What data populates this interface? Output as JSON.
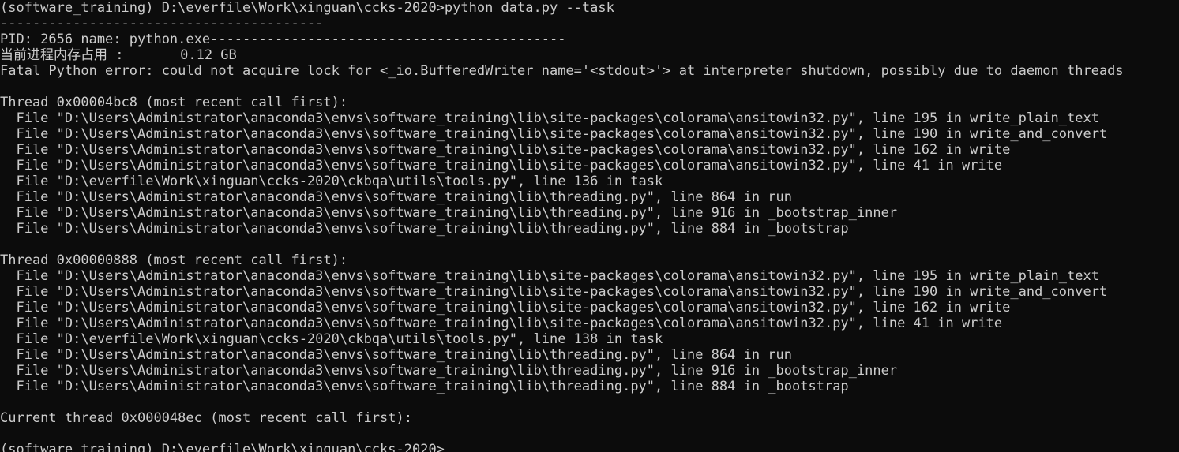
{
  "terminal": {
    "lines": [
      "(software_training) D:\\everfile\\Work\\xinguan\\ccks-2020>python data.py --task",
      "----------------------------------------",
      "PID: 2656 name: python.exe--------------------------------------------",
      "当前进程内存占用 :       0.12 GB",
      "Fatal Python error: could not acquire lock for <_io.BufferedWriter name='<stdout>'> at interpreter shutdown, possibly due to daemon threads",
      "",
      "Thread 0x00004bc8 (most recent call first):",
      "  File \"D:\\Users\\Administrator\\anaconda3\\envs\\software_training\\lib\\site-packages\\colorama\\ansitowin32.py\", line 195 in write_plain_text",
      "  File \"D:\\Users\\Administrator\\anaconda3\\envs\\software_training\\lib\\site-packages\\colorama\\ansitowin32.py\", line 190 in write_and_convert",
      "  File \"D:\\Users\\Administrator\\anaconda3\\envs\\software_training\\lib\\site-packages\\colorama\\ansitowin32.py\", line 162 in write",
      "  File \"D:\\Users\\Administrator\\anaconda3\\envs\\software_training\\lib\\site-packages\\colorama\\ansitowin32.py\", line 41 in write",
      "  File \"D:\\everfile\\Work\\xinguan\\ccks-2020\\ckbqa\\utils\\tools.py\", line 136 in task",
      "  File \"D:\\Users\\Administrator\\anaconda3\\envs\\software_training\\lib\\threading.py\", line 864 in run",
      "  File \"D:\\Users\\Administrator\\anaconda3\\envs\\software_training\\lib\\threading.py\", line 916 in _bootstrap_inner",
      "  File \"D:\\Users\\Administrator\\anaconda3\\envs\\software_training\\lib\\threading.py\", line 884 in _bootstrap",
      "",
      "Thread 0x00000888 (most recent call first):",
      "  File \"D:\\Users\\Administrator\\anaconda3\\envs\\software_training\\lib\\site-packages\\colorama\\ansitowin32.py\", line 195 in write_plain_text",
      "  File \"D:\\Users\\Administrator\\anaconda3\\envs\\software_training\\lib\\site-packages\\colorama\\ansitowin32.py\", line 190 in write_and_convert",
      "  File \"D:\\Users\\Administrator\\anaconda3\\envs\\software_training\\lib\\site-packages\\colorama\\ansitowin32.py\", line 162 in write",
      "  File \"D:\\Users\\Administrator\\anaconda3\\envs\\software_training\\lib\\site-packages\\colorama\\ansitowin32.py\", line 41 in write",
      "  File \"D:\\everfile\\Work\\xinguan\\ccks-2020\\ckbqa\\utils\\tools.py\", line 138 in task",
      "  File \"D:\\Users\\Administrator\\anaconda3\\envs\\software_training\\lib\\threading.py\", line 864 in run",
      "  File \"D:\\Users\\Administrator\\anaconda3\\envs\\software_training\\lib\\threading.py\", line 916 in _bootstrap_inner",
      "  File \"D:\\Users\\Administrator\\anaconda3\\envs\\software_training\\lib\\threading.py\", line 884 in _bootstrap",
      "",
      "Current thread 0x000048ec (most recent call first):",
      "",
      "(software_training) D:\\everfile\\Work\\xinguan\\ccks-2020>"
    ],
    "colors": {
      "background": "#0c0c0c",
      "text": "#cccccc"
    }
  }
}
